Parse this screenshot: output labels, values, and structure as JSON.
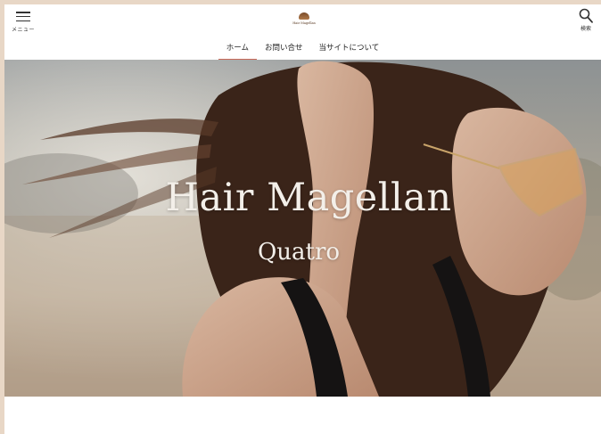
{
  "header": {
    "menu_label": "メニュー",
    "search_label": "検索",
    "logo_text": "Hair Magellan"
  },
  "nav": {
    "items": [
      {
        "label": "ホーム",
        "active": true
      },
      {
        "label": "お問い合せ",
        "active": false
      },
      {
        "label": "当サイトについて",
        "active": false
      }
    ]
  },
  "hero": {
    "title": "Hair Magellan",
    "subtitle": "Quatro"
  },
  "colors": {
    "page_background": "#e8d7c6",
    "nav_active_underline": "#c96a5a",
    "hero_text": "#f3efe9"
  }
}
